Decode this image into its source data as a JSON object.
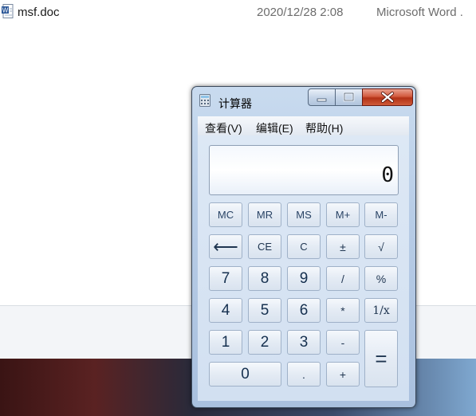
{
  "explorer": {
    "file": {
      "icon": "word-document-icon",
      "name": "msf.doc",
      "date": "2020/12/28 2:08",
      "type": "Microsoft Word ."
    }
  },
  "calculator": {
    "title": "计算器",
    "icon": "calculator-icon",
    "menu": [
      "查看(V)",
      "编辑(E)",
      "帮助(H)"
    ],
    "display": "0",
    "keys": {
      "mc": "MC",
      "mr": "MR",
      "ms": "MS",
      "mplus": "M+",
      "mminus": "M-",
      "backspace": "⟵",
      "ce": "CE",
      "c": "C",
      "plusminus": "±",
      "sqrt": "√",
      "seven": "7",
      "eight": "8",
      "nine": "9",
      "divide": "/",
      "percent": "%",
      "four": "4",
      "five": "5",
      "six": "6",
      "multiply": "*",
      "reciprocal": "1/x",
      "one": "1",
      "two": "2",
      "three": "3",
      "minus": "-",
      "equals": "=",
      "zero": "0",
      "decimal": ".",
      "plus": "+"
    }
  },
  "colors": {
    "window_frame": "#a9c0de",
    "close_button": "#c8452a",
    "key_text": "#1f3550"
  }
}
